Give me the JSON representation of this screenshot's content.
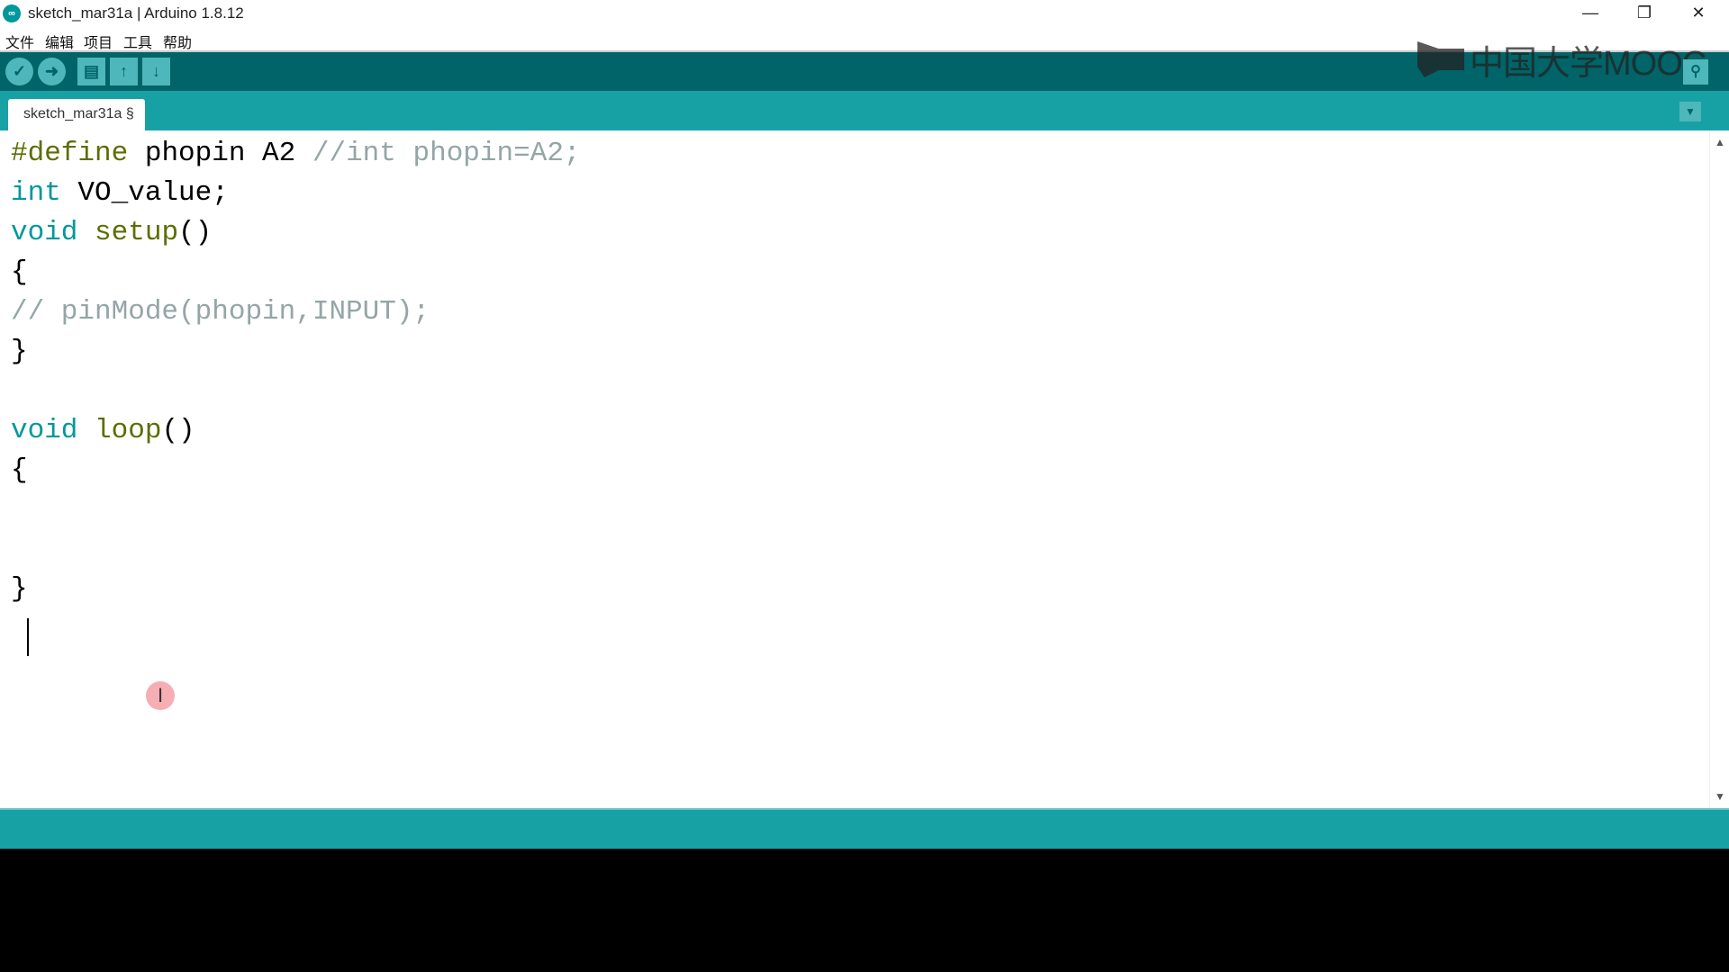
{
  "window": {
    "title": "sketch_mar31a | Arduino 1.8.12",
    "icon": "arduino-logo-icon",
    "minimize": "—",
    "restore": "❐",
    "close": "✕"
  },
  "menu": [
    "文件",
    "编辑",
    "项目",
    "工具",
    "帮助"
  ],
  "toolbar": {
    "verify": "✓",
    "upload": "➜",
    "new": "▤",
    "open": "↑",
    "save": "↓",
    "serial_monitor": "⚲"
  },
  "watermark": "中国大学MOOC",
  "tab": {
    "label": "sketch_mar31a §",
    "menu": "▼"
  },
  "colors": {
    "toolbar": "#006468",
    "tabbar": "#17a1a5",
    "keyword": "#00979c",
    "function": "#5e6d03",
    "comment": "#95a5a6"
  },
  "code": [
    [
      [
        "#define",
        "pp"
      ],
      [
        " phopin A2 ",
        "pl"
      ],
      [
        "//int phopin=A2;",
        "cm"
      ]
    ],
    [
      [
        "int",
        "kw"
      ],
      [
        " VO_value;",
        "pl"
      ]
    ],
    [
      [
        "void",
        "kw"
      ],
      [
        " ",
        "pl"
      ],
      [
        "setup",
        "fn"
      ],
      [
        "()",
        "pl"
      ]
    ],
    [
      [
        "{",
        "pl"
      ]
    ],
    [
      [
        "// pinMode(phopin,INPUT);",
        "cm"
      ]
    ],
    [
      [
        "}",
        "pl"
      ]
    ],
    [],
    [
      [
        "void",
        "kw"
      ],
      [
        " ",
        "pl"
      ],
      [
        "loop",
        "fn"
      ],
      [
        "()",
        "pl"
      ]
    ],
    [
      [
        "{",
        "pl"
      ]
    ],
    [],
    [],
    [
      [
        "}",
        "pl"
      ]
    ]
  ],
  "scroll": {
    "up": "▲",
    "down": "▼"
  },
  "mouse_cursor": "I"
}
